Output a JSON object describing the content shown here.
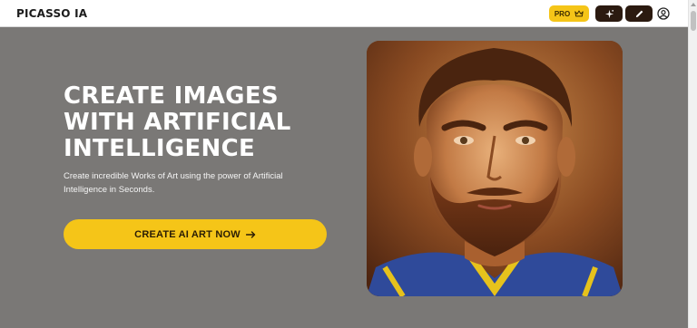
{
  "header": {
    "logo_text": "PICASSO IA",
    "pro_label": "PRO",
    "icons": {
      "pro": "crown-icon",
      "magic": "sparkle-icon",
      "edit": "pencil-icon",
      "account": "user-circle-icon"
    }
  },
  "hero": {
    "title": "CREATE IMAGES WITH ARTIFICIAL INTELLIGENCE",
    "subtitle": "Create incredible Works of Art using the power of Artificial Intelligence in Seconds.",
    "cta_label": "CREATE AI ART NOW",
    "cta_icon": "arrow-right-icon"
  },
  "colors": {
    "accent": "#f5c518",
    "hero_bg": "#7a7876",
    "dark_button": "#2b1a10"
  }
}
